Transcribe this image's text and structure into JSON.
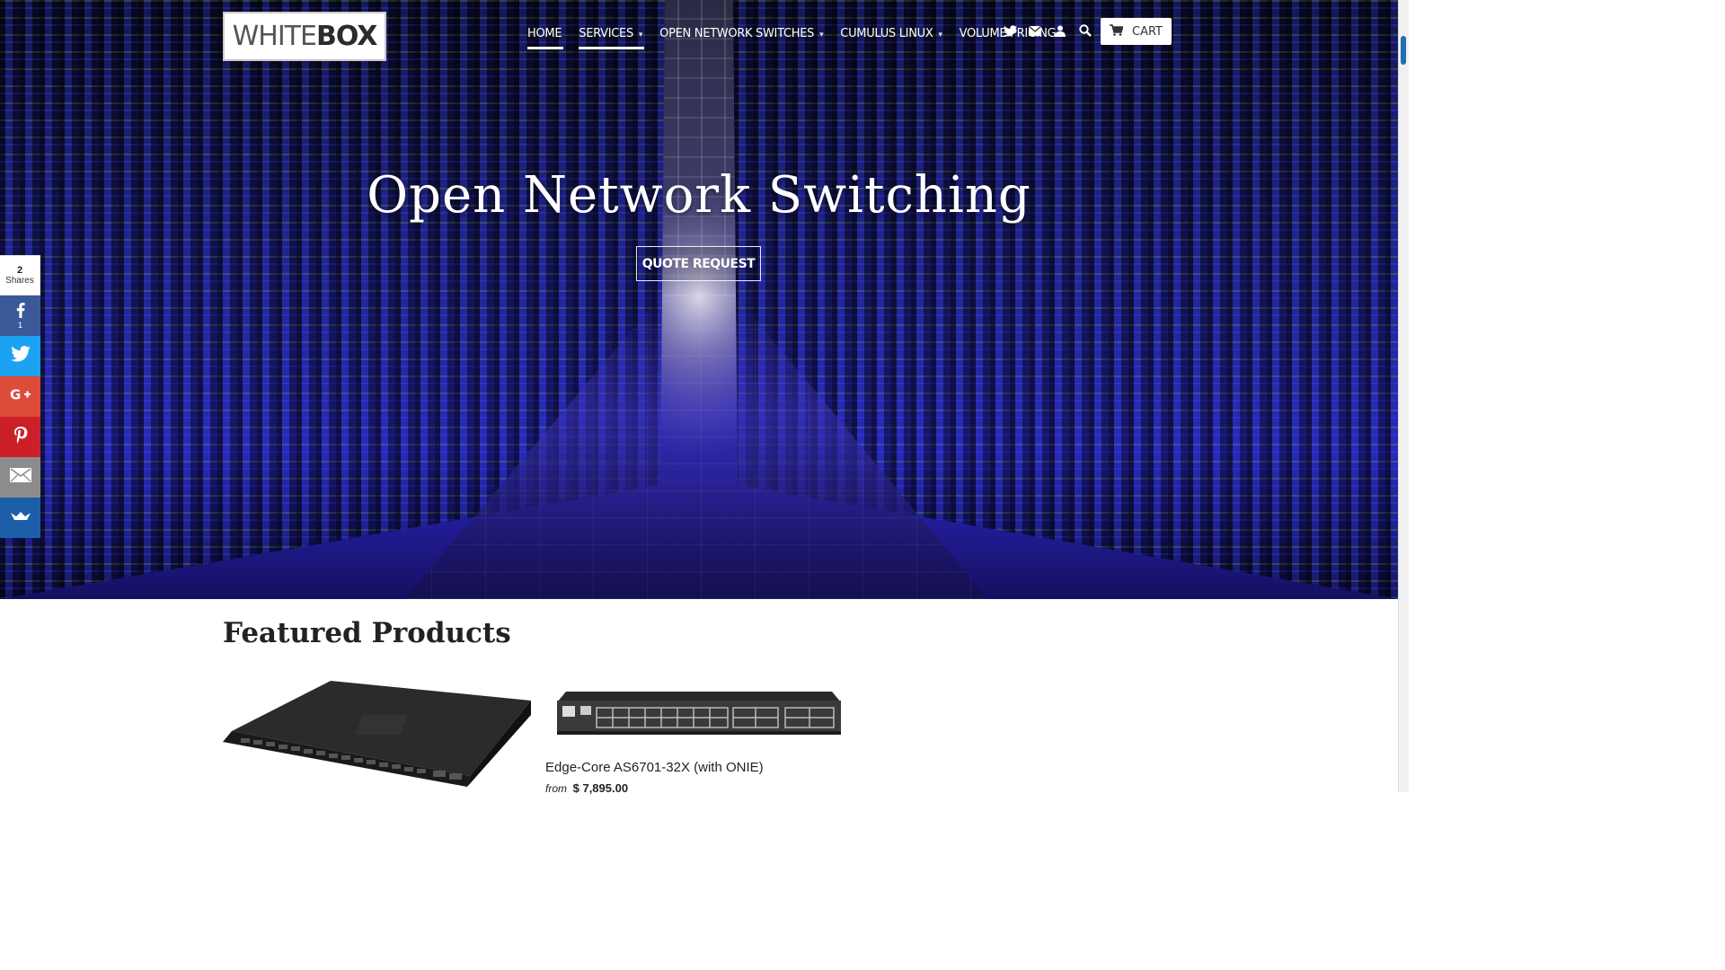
{
  "logo": {
    "part1": "WHITE",
    "part2": "BOX"
  },
  "nav": {
    "items": [
      {
        "label": "HOME",
        "caret": ""
      },
      {
        "label": "SERVICES",
        "caret": "▾"
      },
      {
        "label": "OPEN NETWORK SWITCHES",
        "caret": "▾"
      },
      {
        "label": "CUMULUS LINUX",
        "caret": "▾"
      },
      {
        "label": "VOLUME PRICING",
        "caret": ""
      }
    ]
  },
  "header_icons": [
    "twitter-icon",
    "mail-icon",
    "account-icon",
    "search-icon"
  ],
  "cart": {
    "label": "CART"
  },
  "hero": {
    "title": "Open Network Switching",
    "button": "QUOTE REQUEST"
  },
  "share": {
    "count": "2",
    "count_label": "Shares",
    "facebook_count": "1",
    "buttons": [
      "facebook-icon",
      "twitter-icon",
      "google-plus-icon",
      "pinterest-icon",
      "email-icon",
      "sumome-icon"
    ]
  },
  "featured": {
    "title": "Featured Products",
    "products": [
      {
        "title": "",
        "price": ""
      },
      {
        "title": "Edge-Core AS6701-32X (with ONIE)",
        "price_prefix": "from",
        "price": "$ 7,895.00"
      }
    ]
  },
  "colors": {
    "facebook": "#3b5998",
    "twitter": "#1da1f2",
    "google_plus": "#dd4b39",
    "pinterest": "#cb2027",
    "email": "#8c8c8c",
    "sumome": "#1d5ea8"
  }
}
